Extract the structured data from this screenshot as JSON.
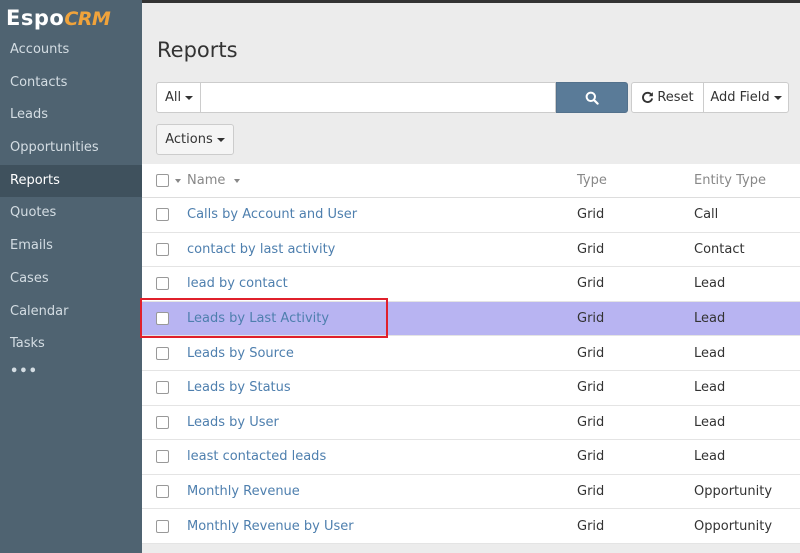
{
  "app": {
    "logo_main": "Espo",
    "logo_accent": "CRM"
  },
  "sidebar": {
    "items": [
      {
        "label": "Accounts"
      },
      {
        "label": "Contacts"
      },
      {
        "label": "Leads"
      },
      {
        "label": "Opportunities"
      },
      {
        "label": "Reports"
      },
      {
        "label": "Quotes"
      },
      {
        "label": "Emails"
      },
      {
        "label": "Cases"
      },
      {
        "label": "Calendar"
      },
      {
        "label": "Tasks"
      }
    ],
    "more_label": "•••",
    "active_item": "Reports"
  },
  "page": {
    "title": "Reports"
  },
  "search": {
    "filter_label": "All",
    "value": "",
    "placeholder": "",
    "search_icon": "search-icon"
  },
  "toolbar": {
    "reset_label": "Reset",
    "reset_icon": "refresh-icon",
    "add_field_label": "Add Field",
    "actions_label": "Actions"
  },
  "table": {
    "columns": {
      "name": "Name",
      "type": "Type",
      "entity_type": "Entity Type"
    },
    "rows": [
      {
        "name": "Calls by Account and User",
        "type": "Grid",
        "entity_type": "Call"
      },
      {
        "name": "contact by last activity",
        "type": "Grid",
        "entity_type": "Contact"
      },
      {
        "name": "lead by contact",
        "type": "Grid",
        "entity_type": "Lead"
      },
      {
        "name": "Leads by Last Activity",
        "type": "Grid",
        "entity_type": "Lead"
      },
      {
        "name": "Leads by Source",
        "type": "Grid",
        "entity_type": "Lead"
      },
      {
        "name": "Leads by Status",
        "type": "Grid",
        "entity_type": "Lead"
      },
      {
        "name": "Leads by User",
        "type": "Grid",
        "entity_type": "Lead"
      },
      {
        "name": "least contacted leads",
        "type": "Grid",
        "entity_type": "Lead"
      },
      {
        "name": "Monthly Revenue",
        "type": "Grid",
        "entity_type": "Opportunity"
      },
      {
        "name": "Monthly Revenue by User",
        "type": "Grid",
        "entity_type": "Opportunity"
      }
    ],
    "highlighted_row": "Leads by Last Activity"
  },
  "colors": {
    "sidebar_bg": "#4f6371",
    "accent": "#f0a33b",
    "link": "#4e7fae",
    "primary_button": "#5a7b98",
    "highlight_row": "#b8b4f2",
    "annotation_border": "#e0202b"
  }
}
